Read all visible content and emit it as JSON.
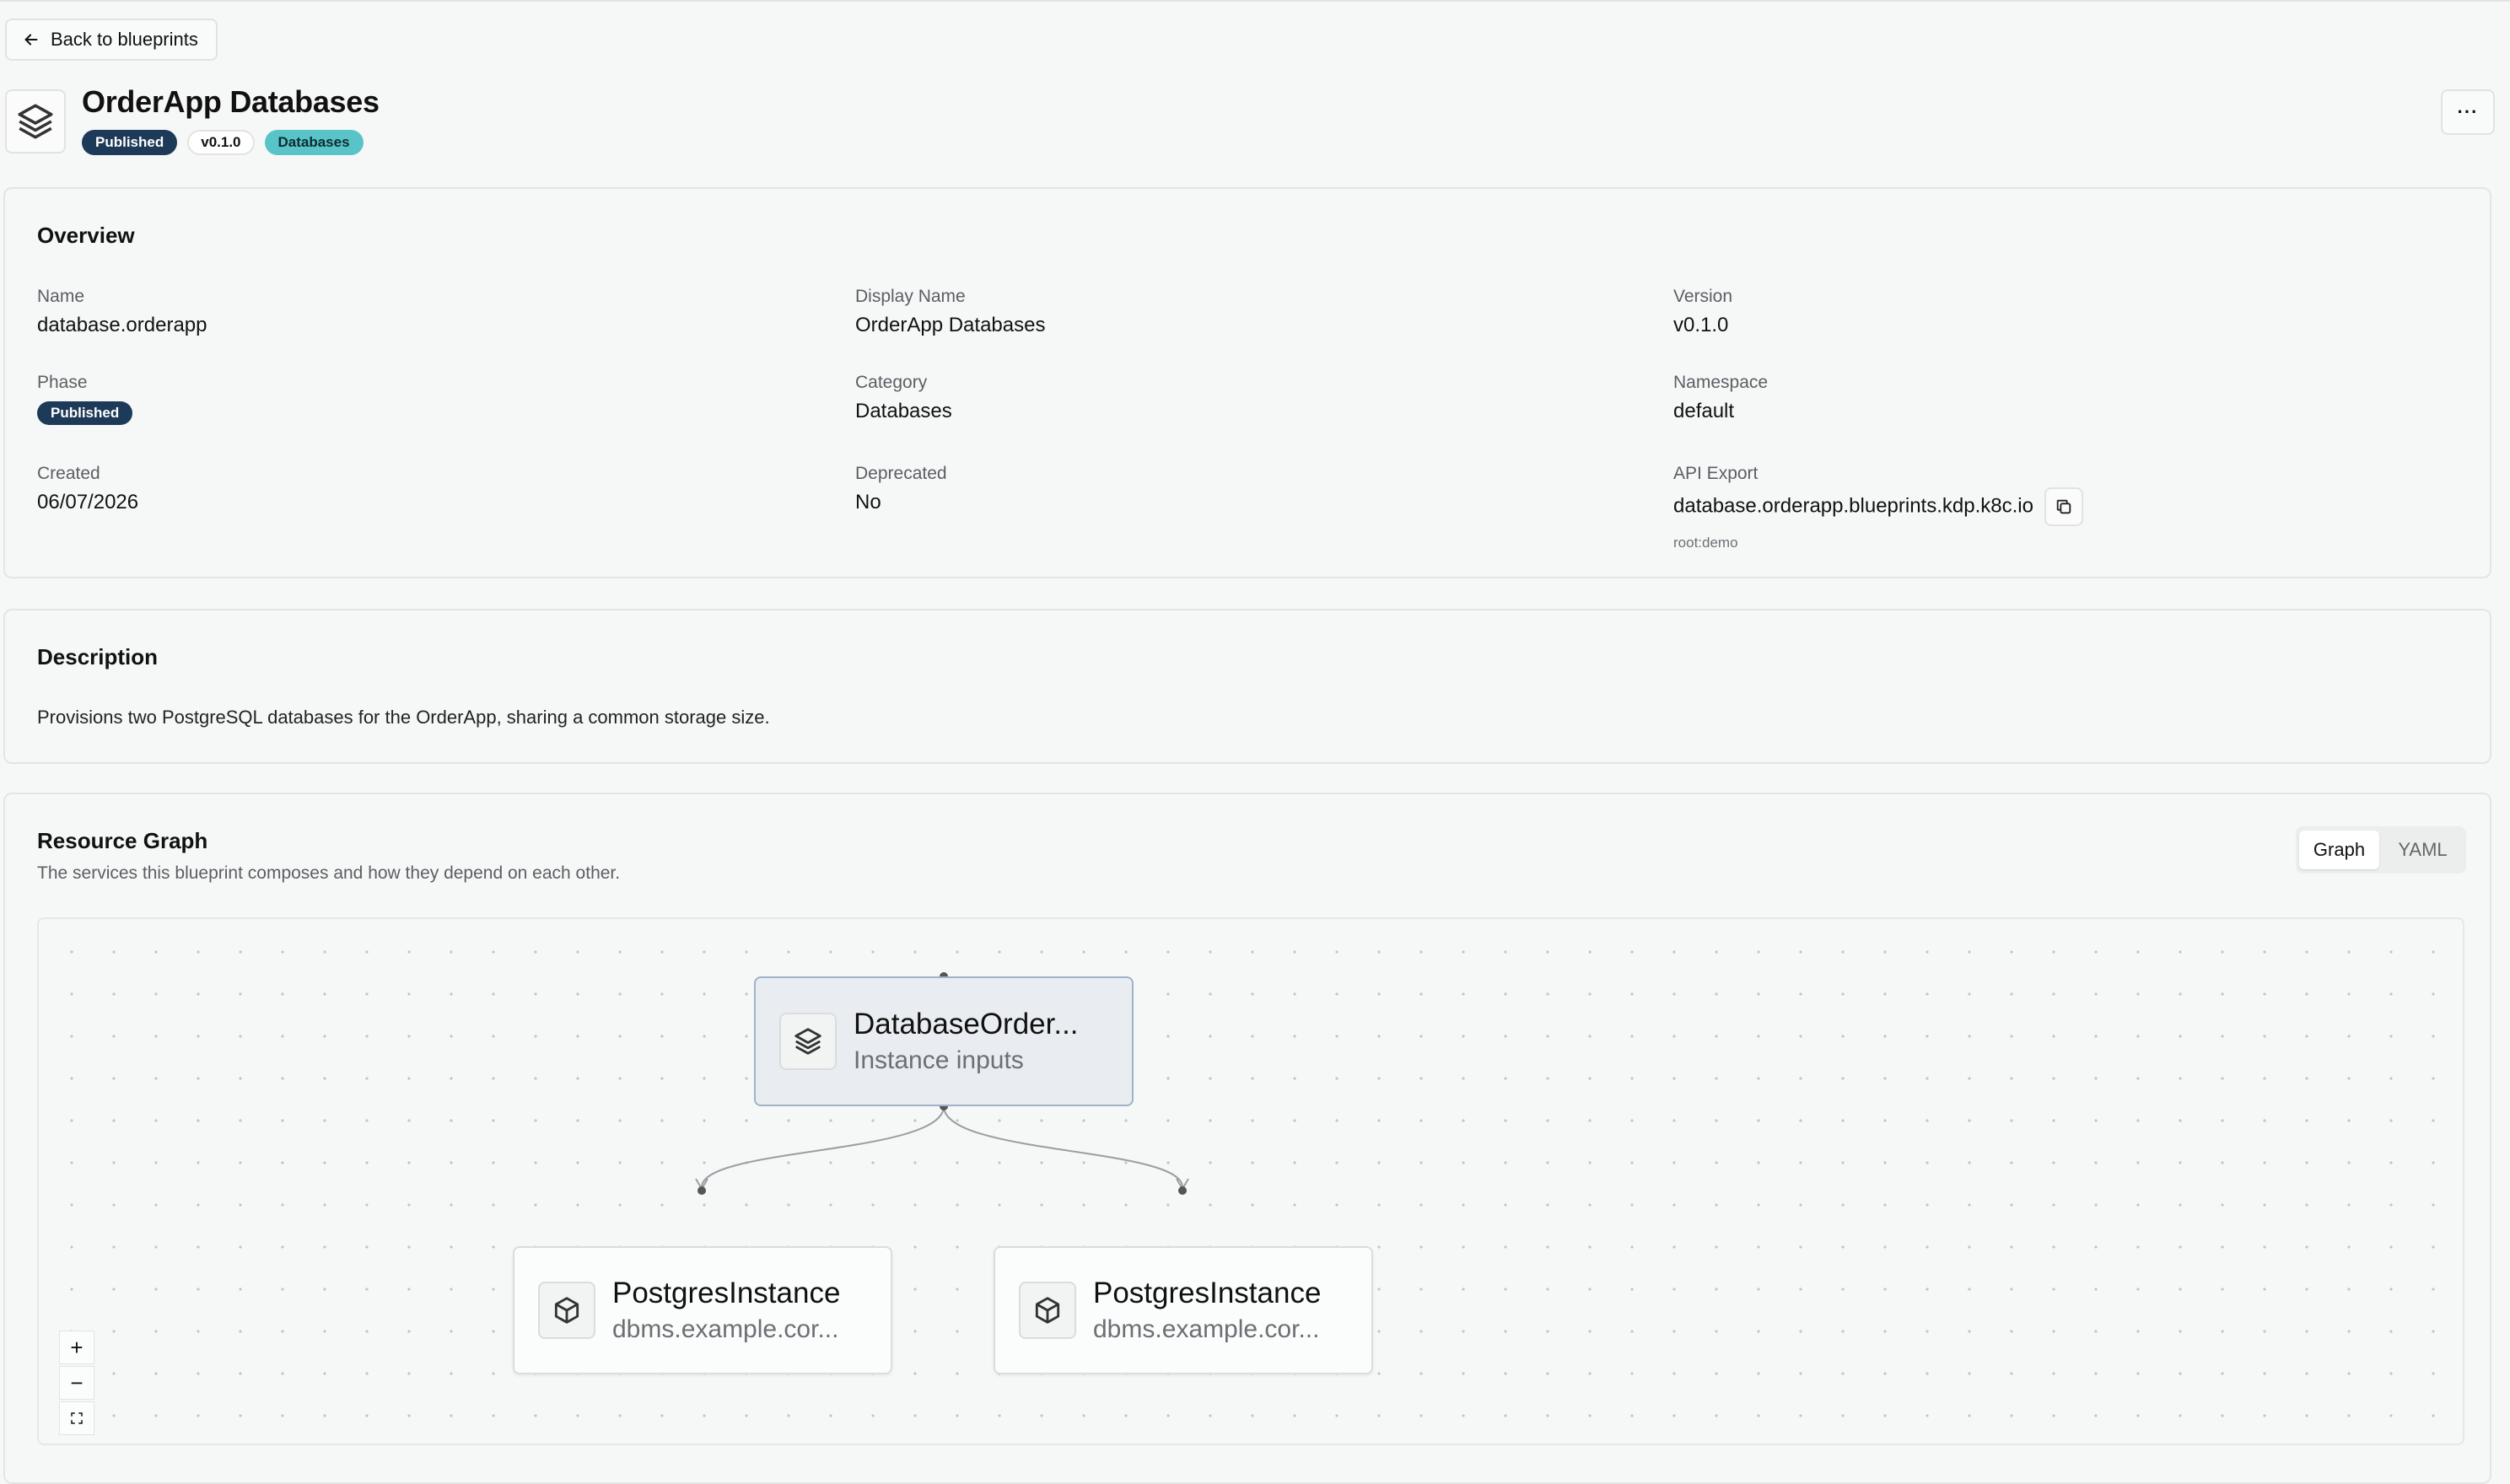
{
  "nav": {
    "back_label": "Back to blueprints"
  },
  "header": {
    "title": "OrderApp Databases",
    "badges": {
      "phase": "Published",
      "version": "v0.1.0",
      "category": "Databases"
    },
    "more_label": "···"
  },
  "overview": {
    "title": "Overview",
    "name": {
      "label": "Name",
      "value": "database.orderapp"
    },
    "display_name": {
      "label": "Display Name",
      "value": "OrderApp Databases"
    },
    "version": {
      "label": "Version",
      "value": "v0.1.0"
    },
    "phase": {
      "label": "Phase",
      "value": "Published"
    },
    "category": {
      "label": "Category",
      "value": "Databases"
    },
    "namespace": {
      "label": "Namespace",
      "value": "default"
    },
    "created": {
      "label": "Created",
      "value": "06/07/2026"
    },
    "deprecated": {
      "label": "Deprecated",
      "value": "No"
    },
    "api_export": {
      "label": "API Export",
      "value": "database.orderapp.blueprints.kdp.k8c.io",
      "note": "root:demo"
    }
  },
  "description": {
    "title": "Description",
    "text": "Provisions two PostgreSQL databases for the OrderApp, sharing a common storage size."
  },
  "graph": {
    "title": "Resource Graph",
    "subtitle": "The services this blueprint composes and how they depend on each other.",
    "tabs": [
      "Graph",
      "YAML"
    ],
    "active_tab": "Graph",
    "root": {
      "title": "DatabaseOrder...",
      "subtitle": "Instance inputs"
    },
    "children": [
      {
        "title": "PostgresInstance",
        "subtitle": "dbms.example.cor..."
      },
      {
        "title": "PostgresInstance",
        "subtitle": "dbms.example.cor..."
      }
    ],
    "controls": {
      "zoom_in": "+",
      "zoom_out": "−"
    }
  }
}
